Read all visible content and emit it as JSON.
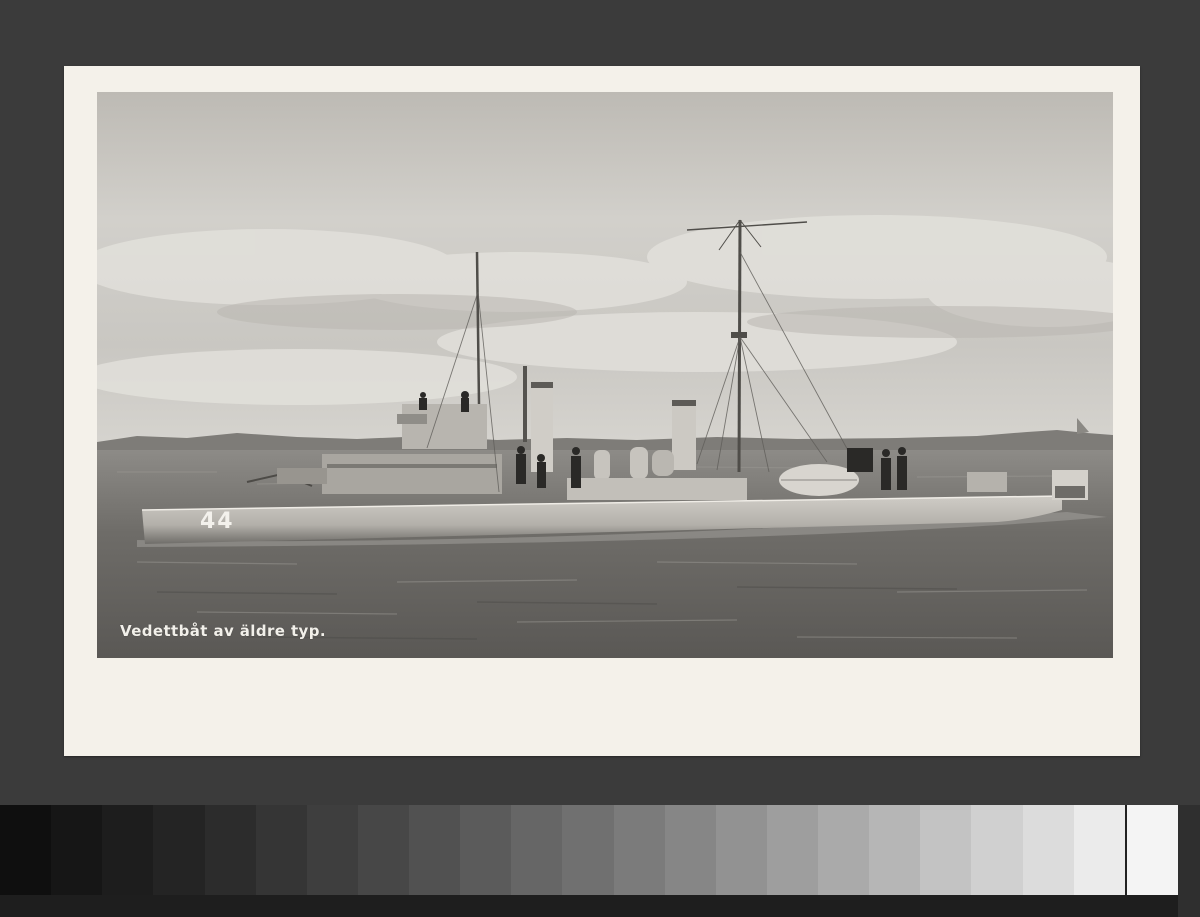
{
  "photo": {
    "caption": "Vedettbåt av äldre typ.",
    "hull_number": "44"
  },
  "gray_scale": {
    "patch_colors": [
      "#0f0f0f",
      "#161616",
      "#1d1d1d",
      "#242424",
      "#2c2c2c",
      "#353535",
      "#3e3e3e",
      "#474747",
      "#515151",
      "#5b5b5b",
      "#666666",
      "#707070",
      "#7b7b7b",
      "#868686",
      "#929292",
      "#9e9e9e",
      "#aaaaaa",
      "#b6b6b6",
      "#c3c3c3",
      "#d0d0d0",
      "#dcdcdc",
      "#ebebeb",
      "#f4f4f4"
    ]
  }
}
